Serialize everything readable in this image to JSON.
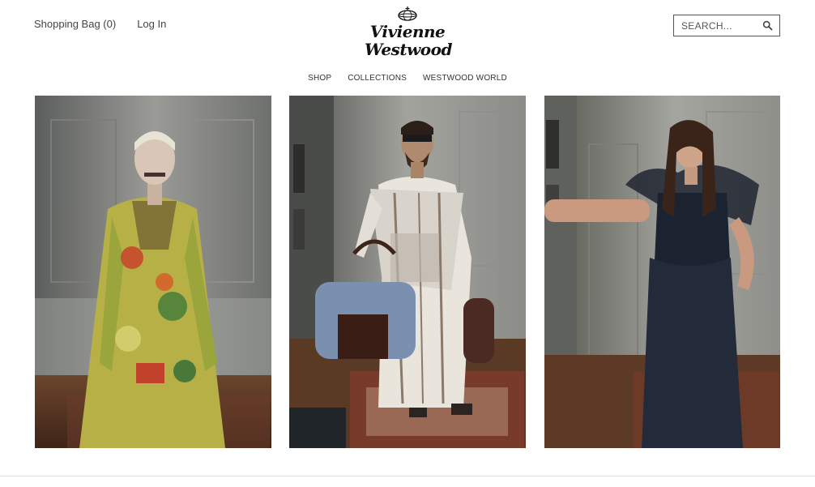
{
  "header": {
    "shopping_bag": "Shopping Bag (0)",
    "login": "Log In",
    "logo_line1": "Vivienne",
    "logo_line2": "Westwood",
    "search_placeholder": "SEARCH..."
  },
  "nav": {
    "items": [
      "SHOP",
      "COLLECTIONS",
      "WESTWOOD WORLD"
    ]
  },
  "gallery": {
    "panels": [
      {
        "subject": "woman-patterned-dress-photo"
      },
      {
        "subject": "man-striped-robe-bag-photo"
      },
      {
        "subject": "woman-black-tulle-dress-photo"
      }
    ]
  },
  "colors": {
    "wall": "#8a8a86",
    "floor": "#5a3a26",
    "text": "#333333",
    "border": "#555555"
  }
}
